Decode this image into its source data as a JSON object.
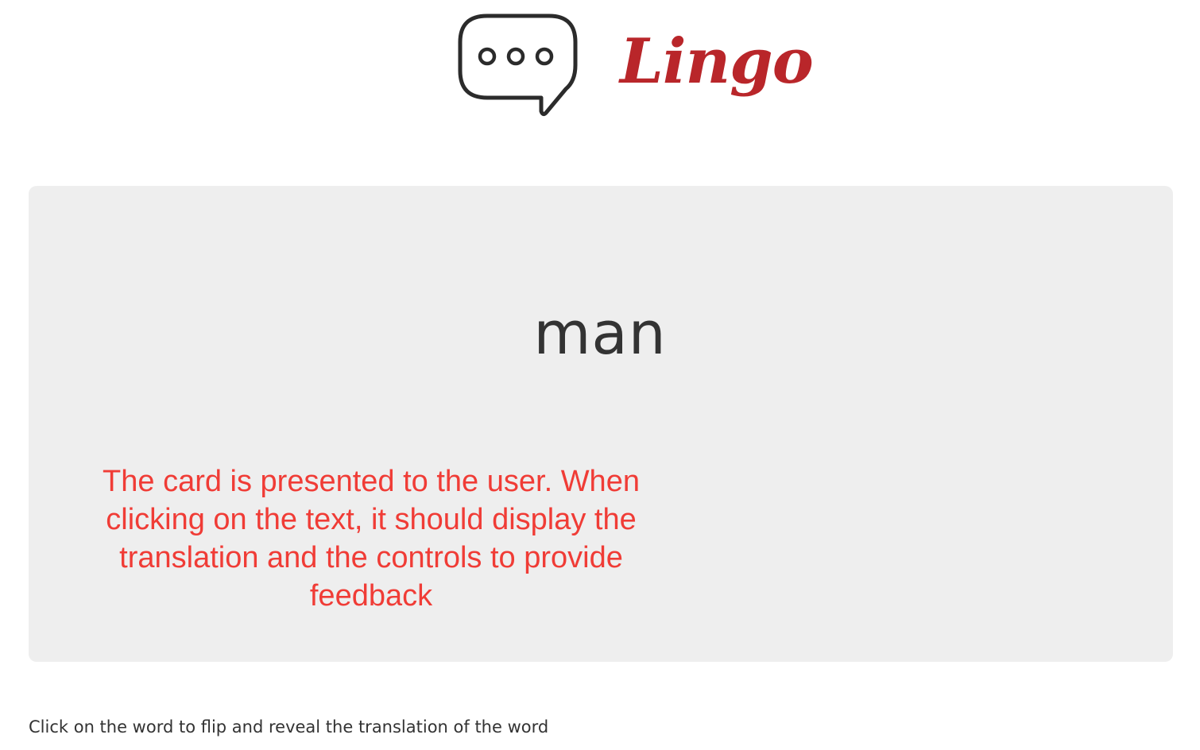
{
  "header": {
    "brand": "Lingo",
    "icon": "speech-bubble-icon",
    "brand_color": "#b9262a"
  },
  "card": {
    "word": "man",
    "background_color": "#eeeeee",
    "annotation": "The card is presented to the user. When clicking on the text, it should display the translation and the controls to provide feedback",
    "annotation_color": "#f03c36"
  },
  "footer": {
    "hint": "Click on the word to flip and reveal the translation of the word"
  }
}
